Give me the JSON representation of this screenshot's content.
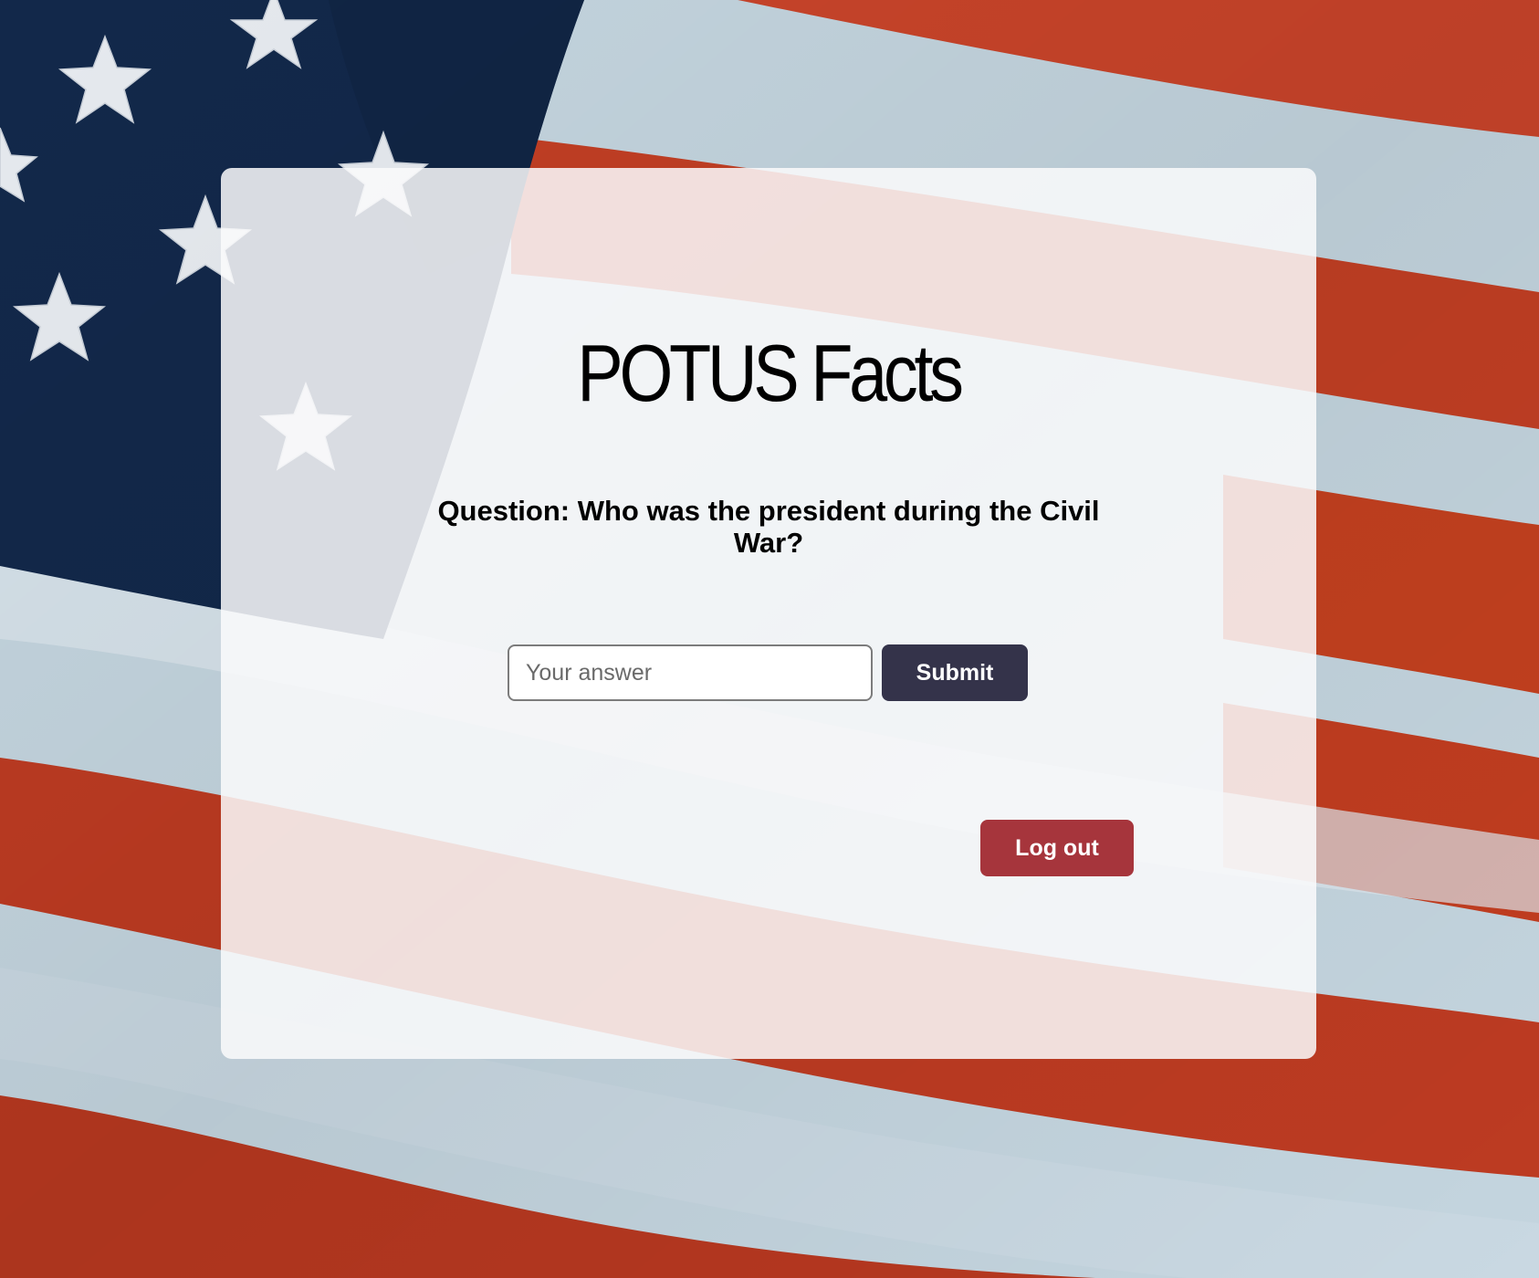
{
  "app": {
    "title": "POTUS Facts"
  },
  "quiz": {
    "question": "Question: Who was the president during the Civil War?",
    "answer_placeholder": "Your answer",
    "answer_value": "",
    "submit_label": "Submit"
  },
  "session": {
    "logout_label": "Log out"
  },
  "background": {
    "image": "american-flag",
    "colors": {
      "canton_blue": "#12284a",
      "stripe_red": "#c43d22",
      "stripe_white": "#c5d6e0",
      "card": "#fafafc"
    }
  },
  "colors": {
    "submit_button": "#34334a",
    "logout_button": "#a6353c",
    "text": "#000000"
  }
}
